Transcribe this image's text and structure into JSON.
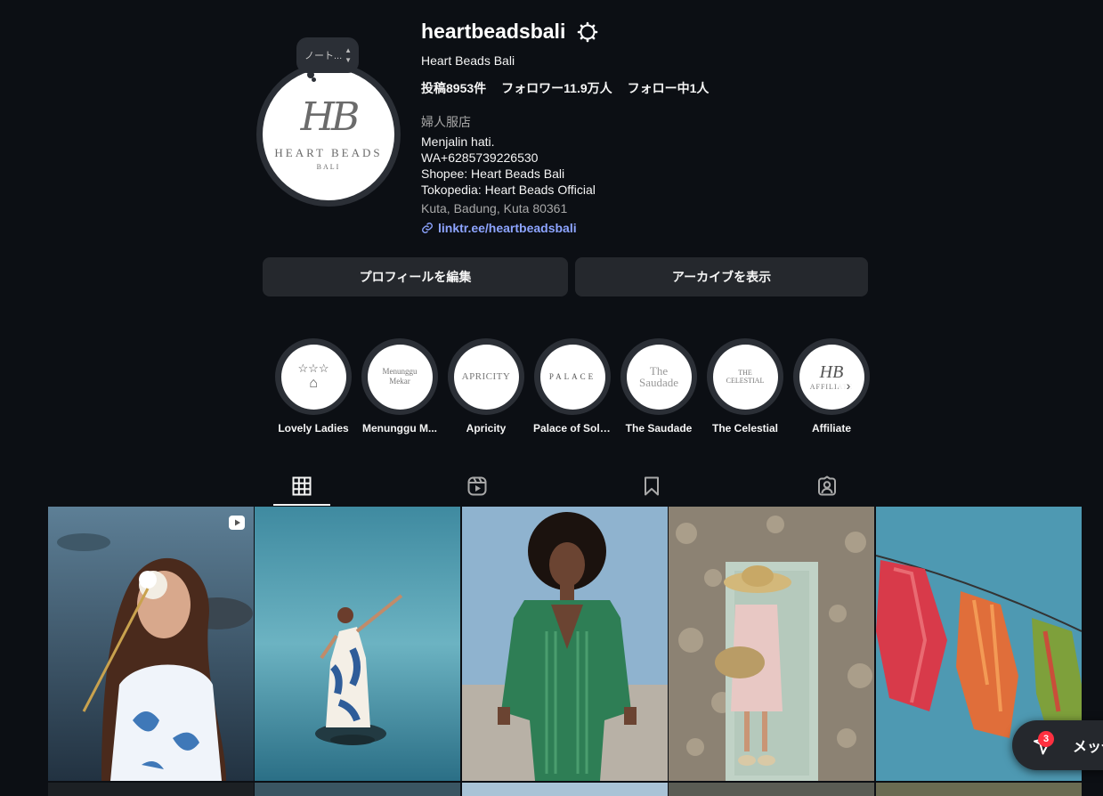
{
  "profile": {
    "username": "heartbeadsbali",
    "full_name": "Heart Beads Bali",
    "note": "ノート...",
    "avatar": {
      "monogram": "HB",
      "brand": "HEART BEADS",
      "sub": "BALI"
    },
    "stats": {
      "posts": "投稿8953件",
      "followers": "フォロワー11.9万人",
      "following": "フォロー中1人"
    },
    "category": "婦人服店",
    "bio": [
      "Menjalin hati.",
      "WA+6285739226530",
      "Shopee: Heart Beads Bali",
      "Tokopedia: Heart Beads Official"
    ],
    "location": "Kuta, Badung, Kuta 80361",
    "link": "linktr.ee/heartbeadsbali",
    "link_color": "#8da4ff"
  },
  "buttons": {
    "edit": "プロフィールを編集",
    "archive": "アーカイブを表示"
  },
  "highlights": [
    {
      "label": "Lovely Ladies",
      "cover": "☆☆☆"
    },
    {
      "label": "Menunggu M...",
      "cover": "Menunggu Mekar"
    },
    {
      "label": "Apricity",
      "cover": "APRICITY"
    },
    {
      "label": "Palace of Sola...",
      "cover": "PALACE"
    },
    {
      "label": "The Saudade",
      "cover": "The Saudade"
    },
    {
      "label": "The Celestial",
      "cover": "THE CELESTIAL"
    },
    {
      "label": "Affiliate",
      "cover": "AFFILIATE"
    }
  ],
  "tabs": [
    "grid-icon",
    "reels-icon",
    "saved-icon",
    "tagged-icon"
  ],
  "messages": {
    "label": "メッセ",
    "badge": "3"
  },
  "colors": {
    "background": "#0c0f14",
    "button": "#25282d",
    "badge": "#ff3040"
  }
}
